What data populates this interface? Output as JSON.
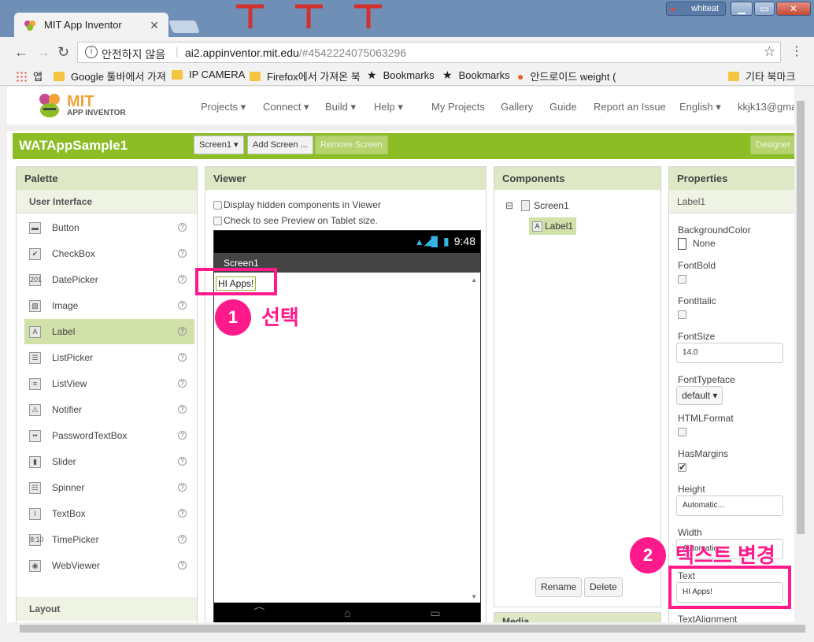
{
  "browser": {
    "tab_title": "MIT App Inventor",
    "tab_close": "✕",
    "user_badge": "whiteat",
    "window_minimize": "▁",
    "window_maximize": "▭",
    "window_close": "✕",
    "nav_back": "←",
    "nav_forward": "→",
    "nav_reload": "↻",
    "security_text": "안전하지 않음",
    "url_host": "ai2.appinventor.mit.edu",
    "url_hash": "/#4542224075063296",
    "bookmark_star": "☆",
    "menu_dots": "⋮",
    "bookmarks": [
      "앱",
      "Google 툴바에서 가져",
      "IP CAMERA",
      "Firefox에서 가져온 북",
      "Bookmarks",
      "Bookmarks",
      "안드로이드 weight (",
      "기타 북마크"
    ]
  },
  "appinventor": {
    "logo_mit": "MIT",
    "logo_sub": "APP INVENTOR",
    "topnav": [
      "Projects ▾",
      "Connect ▾",
      "Build ▾",
      "Help ▾",
      "My Projects",
      "Gallery",
      "Guide",
      "Report an Issue",
      "English ▾",
      "kkjk13@gmai"
    ],
    "project_title": "WATAppSample1",
    "toolbar": {
      "screen_select": "Screen1 ▾",
      "add_screen": "Add Screen ...",
      "remove_screen": "Remove Screen",
      "designer": "Designer"
    }
  },
  "palette": {
    "title": "Palette",
    "category": "User Interface",
    "items": [
      "Button",
      "CheckBox",
      "DatePicker",
      "Image",
      "Label",
      "ListPicker",
      "ListView",
      "Notifier",
      "PasswordTextBox",
      "Slider",
      "Spinner",
      "TextBox",
      "TimePicker",
      "WebViewer"
    ],
    "icons": [
      "▬",
      "✔",
      "201",
      "▨",
      "A",
      "☰",
      "≡",
      "⚠",
      "••",
      "▮",
      "☷",
      "I",
      "8:10",
      "◉"
    ],
    "help": "?",
    "layout_category": "Layout"
  },
  "viewer": {
    "title": "Viewer",
    "check_hidden": "Display hidden components in Viewer",
    "check_tablet": "Check to see Preview on Tablet size.",
    "status_signal": "▲◢▉",
    "status_battery": "▮",
    "status_time": "9:48",
    "screen_title": "Screen1",
    "label_text": "HI Apps!",
    "scroll_up": "▲",
    "scroll_down": "▼",
    "nav_back": "⌒",
    "nav_home": "⌂",
    "nav_recent": "▭"
  },
  "components": {
    "title": "Components",
    "collapse": "⊟",
    "screen": "Screen1",
    "label": "Label1",
    "rename": "Rename",
    "delete": "Delete",
    "media": "Media"
  },
  "properties": {
    "title": "Properties",
    "selected": "Label1",
    "background_color_label": "BackgroundColor",
    "background_color_value": "None",
    "font_bold_label": "FontBold",
    "font_italic_label": "FontItalic",
    "font_size_label": "FontSize",
    "font_size_value": "14.0",
    "font_typeface_label": "FontTypeface",
    "font_typeface_value": "default ▾",
    "html_format_label": "HTMLFormat",
    "has_margins_label": "HasMargins",
    "has_margins_check": "✔",
    "height_label": "Height",
    "height_value": "Automatic...",
    "width_label": "Width",
    "width_value": "Automatic...",
    "text_label": "Text",
    "text_value": "HI Apps!",
    "text_alignment_label": "TextAlignment"
  },
  "annotations": {
    "step1_number": "1",
    "step1_text": "선택",
    "step2_number": "2",
    "step2_text": "텍스트 변경",
    "color": "#ff1a8c"
  }
}
